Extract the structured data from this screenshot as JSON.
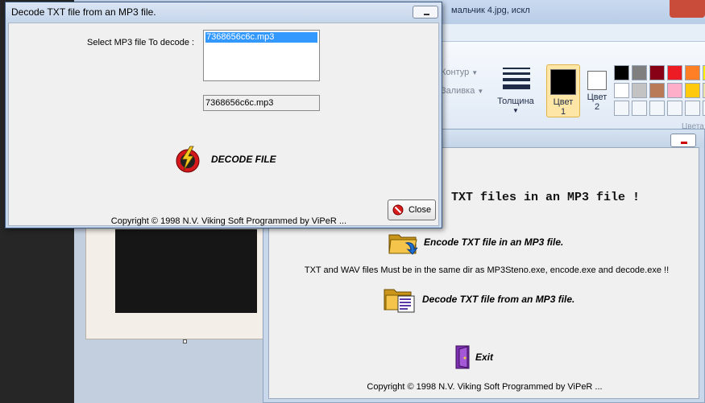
{
  "paint": {
    "title": "мальчик 4.jpg, искл",
    "shape_outline_label": "Контур",
    "shape_fill_label": "Заливка",
    "thickness_label": "Толщина",
    "color1_label_line1": "Цвет",
    "color1_label_line2": "1",
    "color2_label_line1": "Цвет",
    "color2_label_line2": "2",
    "colors_group_label": "Цвета",
    "palette": [
      "#000000",
      "#7f7f7f",
      "#880015",
      "#ed1c24",
      "#ff7f27",
      "#fff200",
      "#ffffff",
      "#c3c3c3",
      "#b97a57",
      "#ffaec9",
      "#ffc90e",
      "#efe4b0"
    ]
  },
  "main_window": {
    "heading": "TXT files in an MP3 file !",
    "encode_label": "Encode TXT file in an MP3 file.",
    "note": "TXT and WAV files Must be in the same dir as MP3Steno.exe, encode.exe and decode.exe !!",
    "decode_label": "Decode TXT file from an MP3 file.",
    "exit_label": "Exit",
    "copyright": "Copyright © 1998 N.V. Viking Soft   Programmed by ViPeR ..."
  },
  "dialog": {
    "title": "Decode TXT file from an MP3 file.",
    "select_label": "Select MP3 file To decode :",
    "files": [
      "7368656c6c.mp3"
    ],
    "selected_file": "7368656c6c.mp3",
    "decode_button": "DECODE FILE",
    "close_button": "Close",
    "copyright": "Copyright © 1998 N.V. Viking Soft   Programmed by ViPeR ..."
  }
}
